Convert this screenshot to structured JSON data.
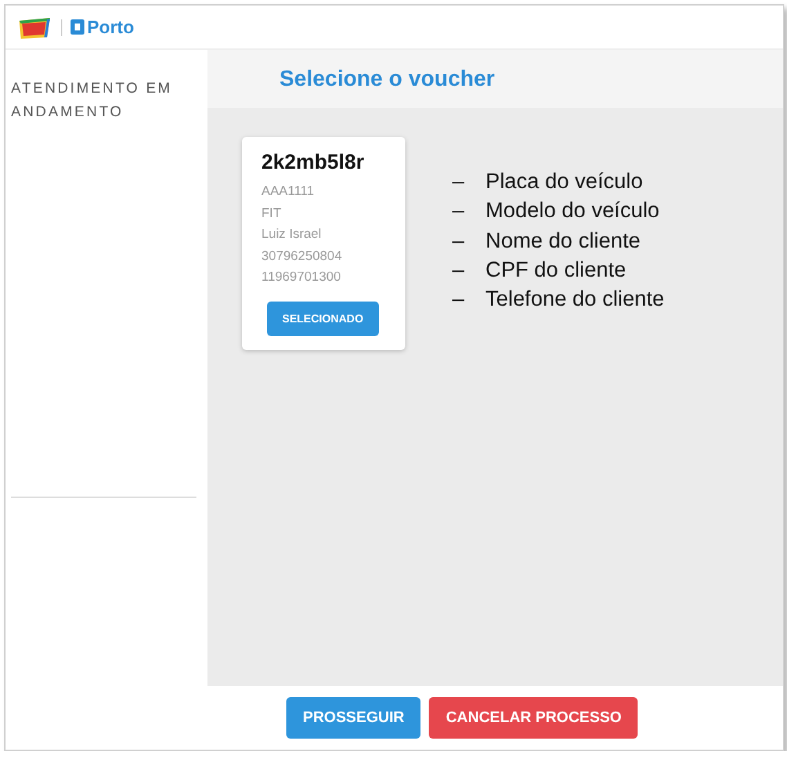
{
  "header": {
    "brand": "Porto"
  },
  "sidebar": {
    "title": "ATENDIMENTO EM ANDAMENTO"
  },
  "page_title": "Selecione o voucher",
  "vouchers": [
    {
      "code": "2k2mb5l8r",
      "details": [
        "AAA1111",
        "FIT",
        "Luiz Israel",
        "30796250804",
        "11969701300"
      ],
      "button": "SELECIONADO",
      "selected": true
    }
  ],
  "notes": [
    {
      "marker": "–",
      "text": "Placa do veículo"
    },
    {
      "marker": "–",
      "text": "Modelo do veículo"
    },
    {
      "marker": "–",
      "text": "Nome do cliente"
    },
    {
      "marker": "–",
      "text": "CPF do cliente"
    },
    {
      "marker": "–",
      "text": "Telefone do cliente"
    }
  ],
  "footer": {
    "buttons": [
      {
        "label": "PROSSEGUIR",
        "kind": "primary"
      },
      {
        "label": "CANCELAR PROCESSO",
        "kind": "danger"
      }
    ]
  }
}
